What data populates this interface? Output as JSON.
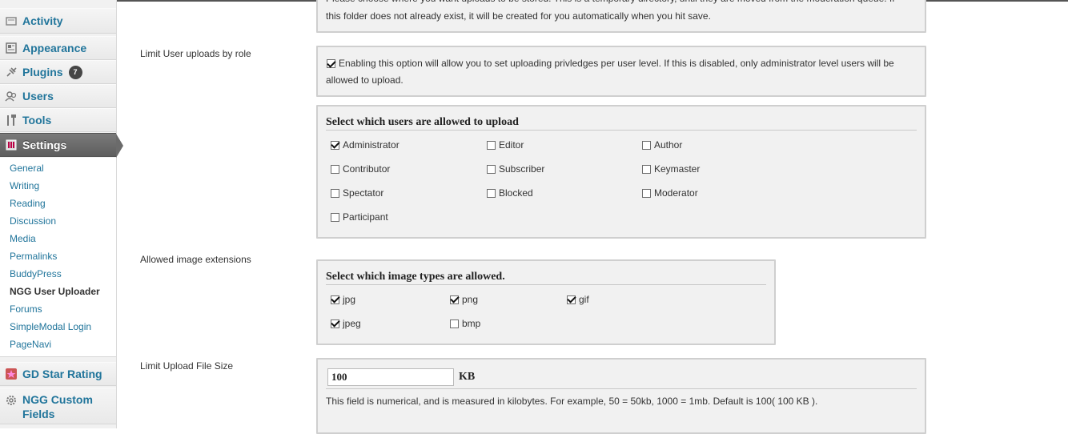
{
  "sidebar": {
    "menu": [
      {
        "label": "Activity"
      },
      {
        "label": "Appearance"
      },
      {
        "label": "Plugins",
        "badge": "7"
      },
      {
        "label": "Users"
      },
      {
        "label": "Tools"
      },
      {
        "label": "Settings"
      },
      {
        "label": "GD Star Rating"
      },
      {
        "label": "NGG Custom Fields"
      }
    ],
    "submenu": [
      "General",
      "Writing",
      "Reading",
      "Discussion",
      "Media",
      "Permalinks",
      "BuddyPress",
      "NGG User Uploader",
      "Forums",
      "SimpleModal Login",
      "PageNavi"
    ]
  },
  "top_box": {
    "line1": "Please choose where you want uploads to be stored. This is a temporary directory, until they are moved from the moderation queue. If",
    "line2": "this folder does not already exist, it will be created for you automatically when you hit save."
  },
  "limit_roles": {
    "label": "Limit User uploads by role",
    "enable_text1": "Enabling this option will allow you to set uploading privledges per user level. If this is disabled, only administrator level users will be",
    "enable_text2": "allowed to upload.",
    "heading": "Select which users are allowed to upload",
    "roles": [
      "Administrator",
      "Editor",
      "Author",
      "Contributor",
      "Subscriber",
      "Keymaster",
      "Spectator",
      "Blocked",
      "Moderator",
      "Participant"
    ]
  },
  "image_ext": {
    "label": "Allowed image extensions",
    "heading": "Select which image types are allowed.",
    "types": [
      "jpg",
      "png",
      "gif",
      "jpeg",
      "bmp"
    ]
  },
  "file_size": {
    "label": "Limit Upload File Size",
    "value": "100",
    "unit": "KB",
    "help": "This field is numerical, and is measured in kilobytes. For example, 50 = 50kb, 1000 = 1mb. Default is 100( 100 KB )."
  }
}
